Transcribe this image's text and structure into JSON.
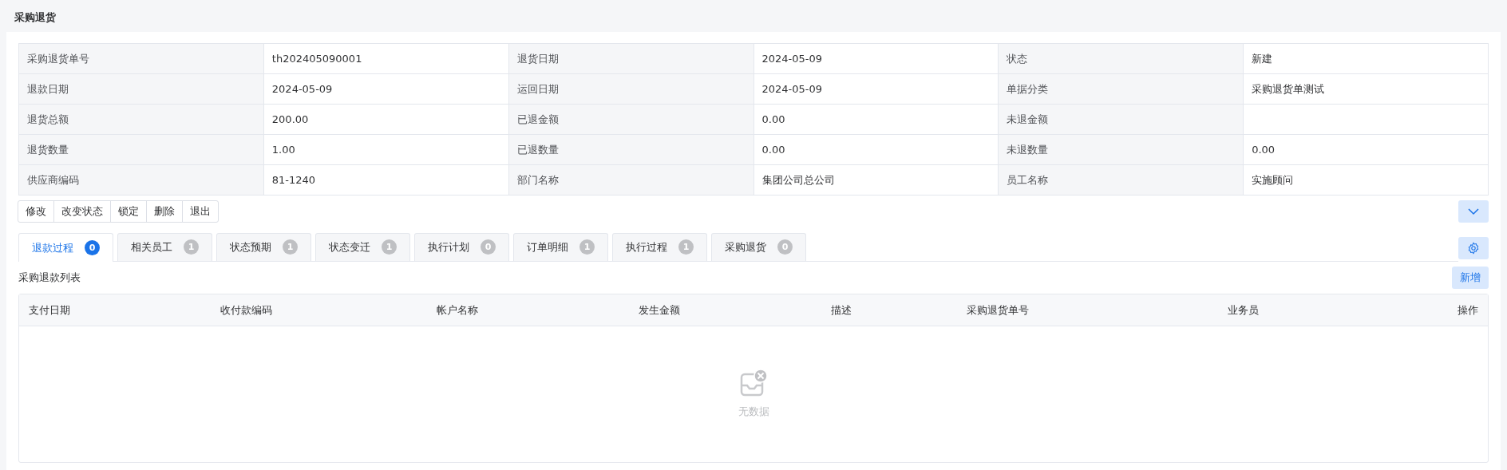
{
  "page_title": "采购退货",
  "details": [
    {
      "label": "采购退货单号",
      "value": "th202405090001"
    },
    {
      "label": "退货日期",
      "value": "2024-05-09"
    },
    {
      "label": "状态",
      "value": "新建"
    },
    {
      "label": "退款日期",
      "value": "2024-05-09"
    },
    {
      "label": "运回日期",
      "value": "2024-05-09"
    },
    {
      "label": "单据分类",
      "value": "采购退货单测试"
    },
    {
      "label": "退货总额",
      "value": "200.00"
    },
    {
      "label": "已退金额",
      "value": "0.00"
    },
    {
      "label": "未退金额"
    },
    {
      "label": "退货数量",
      "value": "1.00"
    },
    {
      "label": "已退数量",
      "value": "0.00"
    },
    {
      "label": "未退数量",
      "value": "0.00"
    },
    {
      "label": "供应商编码",
      "value": "81-1240"
    },
    {
      "label": "部门名称",
      "value": "集团公司总公司"
    },
    {
      "label": "员工名称",
      "value": "实施顾问"
    }
  ],
  "actions": [
    "修改",
    "改变状态",
    "锁定",
    "删除",
    "退出"
  ],
  "tabs": [
    {
      "label": "退款过程",
      "count": "0",
      "selected": true
    },
    {
      "label": "相关员工",
      "count": "1",
      "selected": false
    },
    {
      "label": "状态预期",
      "count": "1",
      "selected": false
    },
    {
      "label": "状态变迁",
      "count": "1",
      "selected": false
    },
    {
      "label": "执行计划",
      "count": "0",
      "selected": false
    },
    {
      "label": "订单明细",
      "count": "1",
      "selected": false
    },
    {
      "label": "执行过程",
      "count": "1",
      "selected": false
    },
    {
      "label": "采购退货",
      "count": "0",
      "selected": false
    }
  ],
  "list": {
    "title": "采购退款列表",
    "add_button": "新增",
    "columns": [
      "支付日期",
      "收付款编码",
      "帐户名称",
      "发生金额",
      "描述",
      "采购退货单号",
      "业务员",
      "操作"
    ],
    "empty_text": "无数据"
  }
}
